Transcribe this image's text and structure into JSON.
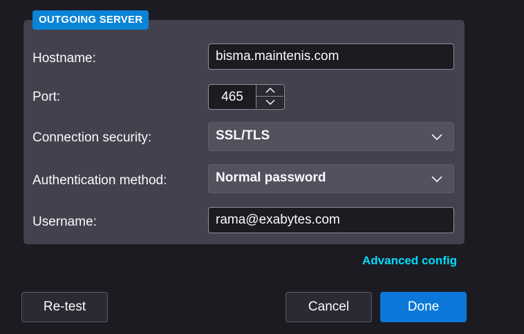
{
  "section": {
    "badge": "OUTGOING SERVER"
  },
  "form": {
    "hostname": {
      "label": "Hostname:",
      "value": "bisma.maintenis.com"
    },
    "port": {
      "label": "Port:",
      "value": "465"
    },
    "connection_security": {
      "label": "Connection security:",
      "value": "SSL/TLS"
    },
    "authentication_method": {
      "label": "Authentication method:",
      "value": "Normal password"
    },
    "username": {
      "label": "Username:",
      "value": "rama@exabytes.com"
    }
  },
  "links": {
    "advanced_config": "Advanced config"
  },
  "buttons": {
    "retest": "Re-test",
    "cancel": "Cancel",
    "done": "Done"
  },
  "colors": {
    "background": "#1c1b22",
    "panel": "#42414d",
    "badge": "#0a84d6",
    "link": "#00ddff",
    "primary_button": "#0b78d9"
  },
  "icons": {
    "select_arrow": "chevron-down-icon",
    "spin_up": "chevron-up-icon",
    "spin_down": "chevron-down-icon"
  }
}
